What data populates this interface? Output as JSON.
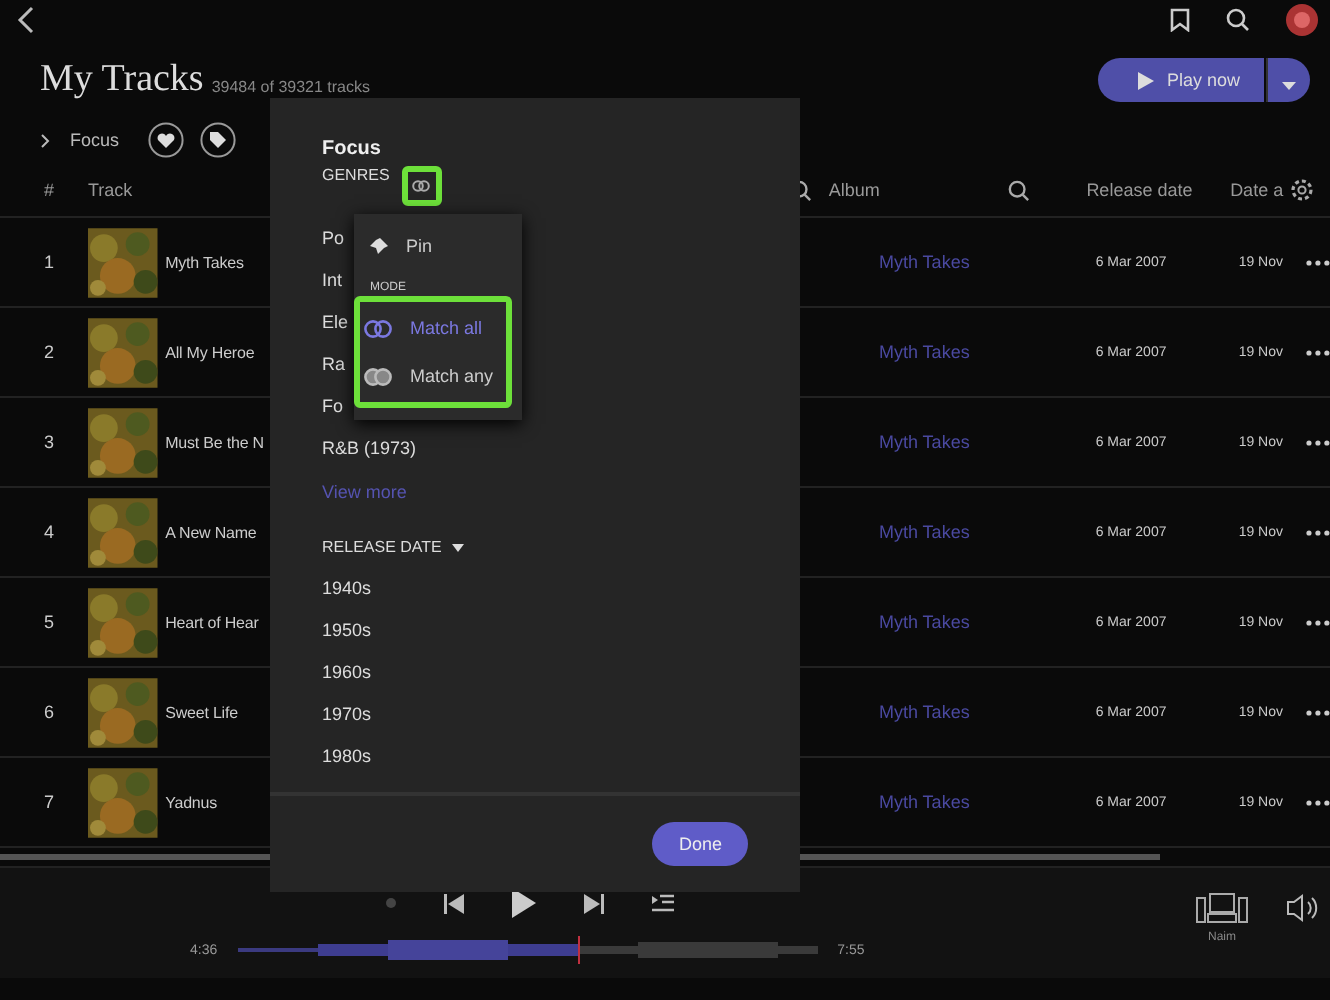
{
  "header": {
    "title": "My Tracks",
    "subtitle": "39484 of 39321 tracks",
    "focus_label": "Focus",
    "play_button": "Play now"
  },
  "table": {
    "columns": [
      "#",
      "Track",
      "Album",
      "Release date",
      "Date a"
    ],
    "rows": [
      {
        "number": "1",
        "track": "Myth Takes",
        "album": "Myth Takes",
        "release_date": "6 Mar 2007",
        "date_added": "19 Nov"
      },
      {
        "number": "2",
        "track": "All My Heroe",
        "album": "Myth Takes",
        "release_date": "6 Mar 2007",
        "date_added": "19 Nov"
      },
      {
        "number": "3",
        "track": "Must Be the N",
        "album": "Myth Takes",
        "release_date": "6 Mar 2007",
        "date_added": "19 Nov"
      },
      {
        "number": "4",
        "track": "A New Name",
        "album": "Myth Takes",
        "release_date": "6 Mar 2007",
        "date_added": "19 Nov"
      },
      {
        "number": "5",
        "track": "Heart of Hear",
        "album": "Myth Takes",
        "release_date": "6 Mar 2007",
        "date_added": "19 Nov"
      },
      {
        "number": "6",
        "track": "Sweet Life",
        "album": "Myth Takes",
        "release_date": "6 Mar 2007",
        "date_added": "19 Nov"
      },
      {
        "number": "7",
        "track": "Yadnus",
        "album": "Myth Takes",
        "release_date": "6 Mar 2007",
        "date_added": "19 Nov"
      }
    ]
  },
  "focus_dialog": {
    "title": "Focus",
    "genres_heading": "GENRES",
    "genres": [
      "Po",
      "Int",
      "Ele",
      "Ra",
      "Fo",
      "R&B (1973)"
    ],
    "view_more": "View more",
    "release_heading": "RELEASE DATE",
    "decades": [
      "1940s",
      "1950s",
      "1960s",
      "1970s",
      "1980s"
    ],
    "done": "Done",
    "menu": {
      "pin": "Pin",
      "mode_heading": "MODE",
      "modes": [
        {
          "label": "Match all",
          "selected": true
        },
        {
          "label": "Match any",
          "selected": false
        }
      ]
    }
  },
  "player": {
    "elapsed": "4:36",
    "total": "7:55",
    "device": "Naim"
  }
}
